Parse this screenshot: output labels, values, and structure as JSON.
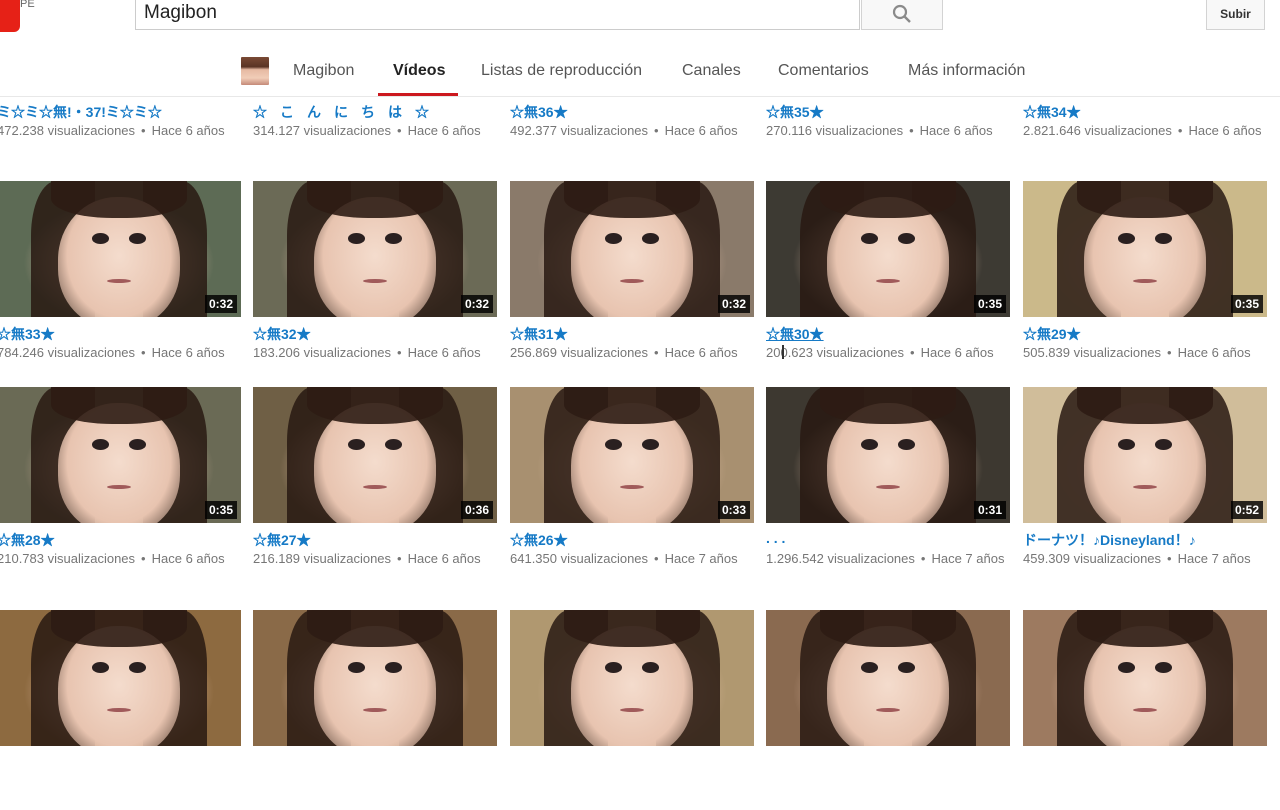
{
  "header": {
    "logo_suffix": "PE",
    "search_value": "Magibon",
    "upload_label": "Subir"
  },
  "tabs": [
    {
      "label": "Magibon"
    },
    {
      "label": "Vídeos"
    },
    {
      "label": "Listas de reproducción"
    },
    {
      "label": "Canales"
    },
    {
      "label": "Comentarios"
    },
    {
      "label": "Más información"
    }
  ],
  "rows": [
    {
      "cards": [
        {
          "title": "ミ☆ミ☆無!・37!ミ☆ミ☆",
          "views": "472.238 visualizaciones",
          "age": "Hace 6 años"
        },
        {
          "title": "☆こんにちは☆",
          "views": "314.127 visualizaciones",
          "age": "Hace 6 años"
        },
        {
          "title": "☆無36★",
          "views": "492.377 visualizaciones",
          "age": "Hace 6 años"
        },
        {
          "title": "☆無35★",
          "views": "270.116 visualizaciones",
          "age": "Hace 6 años"
        },
        {
          "title": "☆無34★",
          "views": "2.821.646 visualizaciones",
          "age": "Hace 6 años"
        }
      ]
    },
    {
      "cards": [
        {
          "title": "☆無33★",
          "views": "784.246 visualizaciones",
          "age": "Hace 6 años",
          "duration": "0:32"
        },
        {
          "title": "☆無32★",
          "views": "183.206 visualizaciones",
          "age": "Hace 6 años",
          "duration": "0:32"
        },
        {
          "title": "☆無31★",
          "views": "256.869 visualizaciones",
          "age": "Hace 6 años",
          "duration": "0:32"
        },
        {
          "title": "☆無30★",
          "views": "200.623 visualizaciones",
          "age": "Hace 6 años",
          "duration": "0:35"
        },
        {
          "title": "☆無29★",
          "views": "505.839 visualizaciones",
          "age": "Hace 6 años",
          "duration": "0:35"
        }
      ]
    },
    {
      "cards": [
        {
          "title": "☆無28★",
          "views": "210.783 visualizaciones",
          "age": "Hace 6 años",
          "duration": "0:35"
        },
        {
          "title": "☆無27★",
          "views": "216.189 visualizaciones",
          "age": "Hace 6 años",
          "duration": "0:36"
        },
        {
          "title": "☆無26★",
          "views": "641.350 visualizaciones",
          "age": "Hace 7 años",
          "duration": "0:33"
        },
        {
          "title": ". . .",
          "views": "1.296.542 visualizaciones",
          "age": "Hace 7 años",
          "duration": "0:31"
        },
        {
          "title": "ドーナツ！♪Disneyland！♪",
          "views": "459.309 visualizaciones",
          "age": "Hace 7 años",
          "duration": "0:52"
        }
      ]
    },
    {
      "cards": [
        {},
        {},
        {},
        {},
        {}
      ]
    }
  ],
  "thumb_colors": [
    [
      "#5d6b55",
      "#6b6a56",
      "#8a7a6a",
      "#3d3a33",
      "#cbb98a"
    ],
    [
      "#6a6a55",
      "#6f5f45",
      "#a89070",
      "#3d3830",
      "#d0bd9a"
    ],
    [
      "#8d6a40",
      "#8a6a48",
      "#b09870",
      "#8a6a50",
      "#9d7a60"
    ],
    [
      "#5d4f3a",
      "#6b5d4e",
      "#c09060",
      "#5a4a3a",
      "#9a8a7a"
    ]
  ]
}
